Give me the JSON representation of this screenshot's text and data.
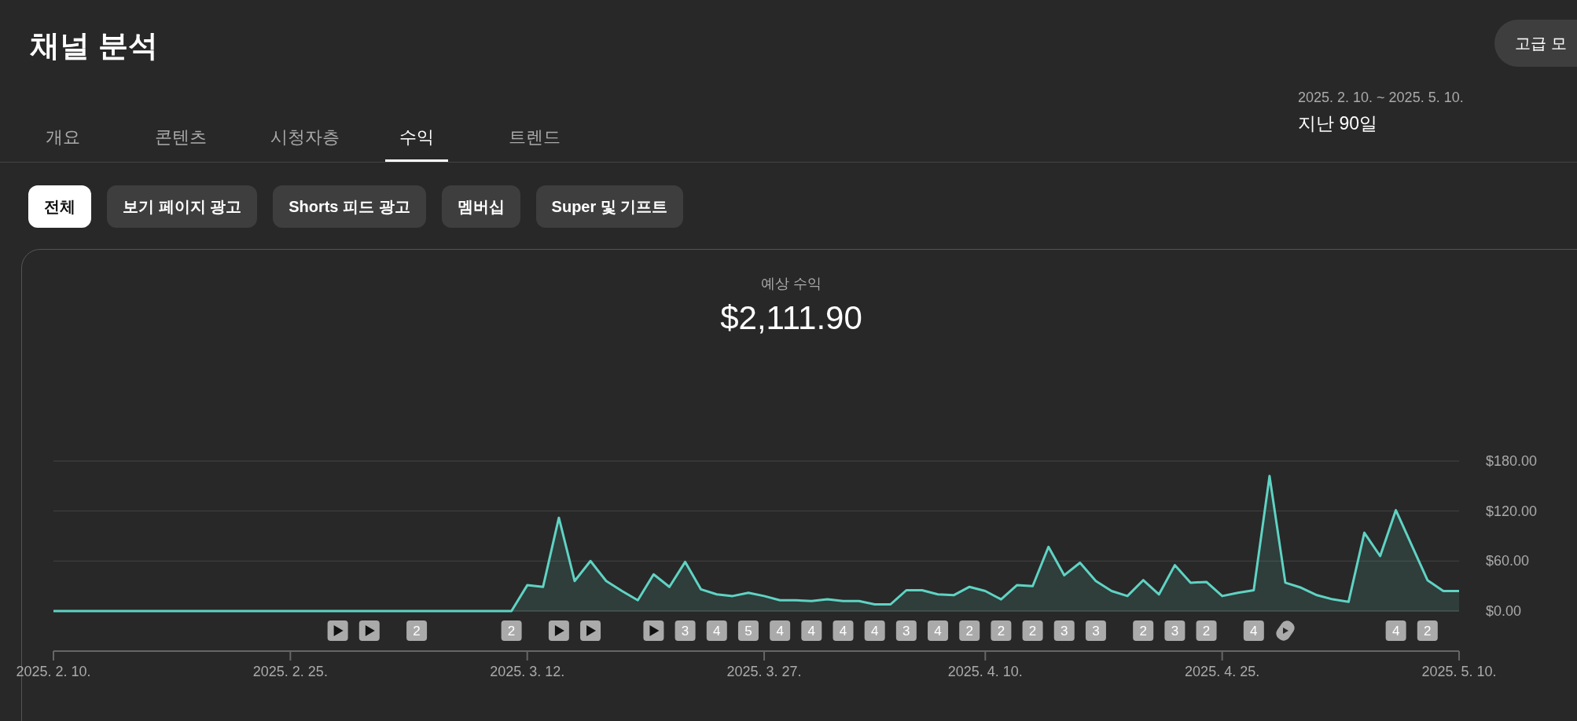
{
  "header": {
    "title": "채널 분석",
    "advanced_button": "고급 모"
  },
  "tabs": [
    {
      "label": "개요",
      "selected": false
    },
    {
      "label": "콘텐츠",
      "selected": false
    },
    {
      "label": "시청자층",
      "selected": false
    },
    {
      "label": "수익",
      "selected": true
    },
    {
      "label": "트렌드",
      "selected": false
    }
  ],
  "date_range": {
    "range": "2025. 2. 10. ~ 2025. 5. 10.",
    "label": "지난 90일"
  },
  "filters": [
    {
      "label": "전체",
      "selected": true
    },
    {
      "label": "보기 페이지 광고",
      "selected": false
    },
    {
      "label": "Shorts 피드 광고",
      "selected": false
    },
    {
      "label": "멤버십",
      "selected": false
    },
    {
      "label": "Super 및 기프트",
      "selected": false
    }
  ],
  "metric": {
    "label": "예상 수익",
    "value": "$2,111.90",
    "chart_data": {
      "type": "area",
      "categories": [
        "2025. 2. 10.",
        null,
        null,
        null,
        null,
        null,
        null,
        null,
        null,
        null,
        null,
        null,
        null,
        null,
        null,
        "2025. 2. 25.",
        null,
        null,
        null,
        null,
        null,
        null,
        null,
        null,
        null,
        null,
        null,
        null,
        null,
        null,
        "2025. 3. 12.",
        null,
        null,
        null,
        null,
        null,
        null,
        null,
        null,
        null,
        null,
        null,
        null,
        null,
        null,
        "2025. 3. 27.",
        null,
        null,
        null,
        null,
        null,
        null,
        null,
        null,
        null,
        null,
        null,
        null,
        null,
        "2025. 4. 10.",
        null,
        null,
        null,
        null,
        null,
        null,
        null,
        null,
        null,
        null,
        null,
        null,
        null,
        null,
        "2025. 4. 25.",
        null,
        null,
        null,
        null,
        null,
        null,
        null,
        null,
        null,
        null,
        null,
        null,
        null,
        null,
        "2025. 5. 10."
      ],
      "values": [
        0,
        0,
        0,
        0,
        0,
        0,
        0,
        0,
        0,
        0,
        0,
        0,
        0,
        0,
        0,
        0,
        0,
        0,
        0,
        0,
        0,
        0,
        0,
        0,
        0,
        0,
        0,
        0,
        0,
        0,
        31,
        29,
        112,
        36,
        60,
        36,
        24,
        13,
        44,
        29,
        59,
        26,
        20,
        18,
        22,
        18,
        13,
        13,
        12,
        14,
        12,
        12,
        8,
        8,
        25,
        25,
        20,
        19,
        29,
        24,
        14,
        31,
        30,
        77,
        43,
        58,
        36,
        24,
        18,
        37,
        20,
        55,
        34,
        35,
        18,
        22,
        25,
        162,
        34,
        28,
        19,
        14,
        11,
        94,
        66,
        121,
        79,
        37,
        24,
        24
      ],
      "ylim": [
        0,
        180
      ],
      "yticks": [
        {
          "value": 0,
          "label": "$0.00"
        },
        {
          "value": 60,
          "label": "$60.00"
        },
        {
          "value": 120,
          "label": "$120.00"
        },
        {
          "value": 180,
          "label": "$180.00"
        }
      ]
    },
    "markers": [
      {
        "kind": "video"
      },
      {
        "kind": "video"
      },
      {
        "kind": "count",
        "label": "2"
      },
      {
        "kind": "count",
        "label": "2"
      },
      {
        "kind": "video"
      },
      {
        "kind": "video"
      },
      {
        "kind": "video"
      },
      {
        "kind": "count",
        "label": "3"
      },
      {
        "kind": "count",
        "label": "4"
      },
      {
        "kind": "count",
        "label": "5"
      },
      {
        "kind": "count",
        "label": "4"
      },
      {
        "kind": "count",
        "label": "4"
      },
      {
        "kind": "count",
        "label": "4"
      },
      {
        "kind": "count",
        "label": "4"
      },
      {
        "kind": "count",
        "label": "3"
      },
      {
        "kind": "count",
        "label": "4"
      },
      {
        "kind": "count",
        "label": "2"
      },
      {
        "kind": "count",
        "label": "2"
      },
      {
        "kind": "count",
        "label": "2"
      },
      {
        "kind": "count",
        "label": "3"
      },
      {
        "kind": "count",
        "label": "3"
      },
      {
        "kind": "count",
        "label": "2"
      },
      {
        "kind": "count",
        "label": "3"
      },
      {
        "kind": "count",
        "label": "2"
      },
      {
        "kind": "count",
        "label": "4"
      },
      {
        "kind": "shorts"
      },
      {
        "kind": "count",
        "label": "4"
      },
      {
        "kind": "count",
        "label": "2"
      }
    ]
  }
}
